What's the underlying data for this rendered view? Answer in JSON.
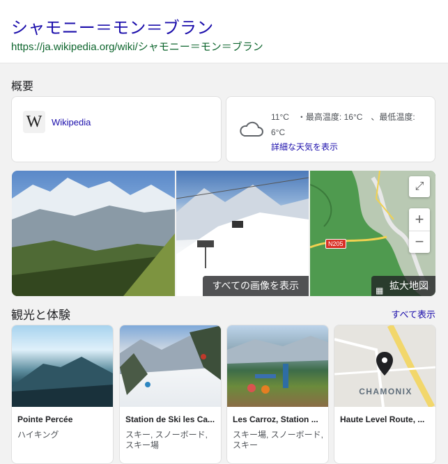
{
  "header": {
    "title": "シャモニー＝モン＝ブラン",
    "url": "https://ja.wikipedia.org/wiki/シャモニー＝モン＝ブラン"
  },
  "overview": {
    "label": "概要",
    "wiki": {
      "logo": "W",
      "link": "Wikipedia"
    },
    "weather": {
      "icon": "cloud-icon",
      "text": "11°C　・最高温度: 16°C　、最低温度: 6°C",
      "link": "詳細な天気を表示"
    }
  },
  "gallery": {
    "see_all_images": "すべての画像を表示",
    "map_label": "拡大地図",
    "road_badge": "N205",
    "zoom_in": "+",
    "zoom_out": "−",
    "expand": "⤢"
  },
  "experiences": {
    "title": "観光と体験",
    "see_all": "すべて表示",
    "items": [
      {
        "name": "Pointe Percée",
        "sub": "ハイキング"
      },
      {
        "name": "Station de Ski les Ca...",
        "sub": "スキー, スノーボード, スキー場"
      },
      {
        "name": "Les Carroz, Station ...",
        "sub": "スキー場, スノーボード, スキー"
      },
      {
        "name": "Haute Level Route, ...",
        "sub": "",
        "map_text": "CHAMONIX"
      }
    ]
  },
  "colors": {
    "link": "#1a0dab",
    "url": "#0d652d",
    "map_pin": "#202124"
  }
}
